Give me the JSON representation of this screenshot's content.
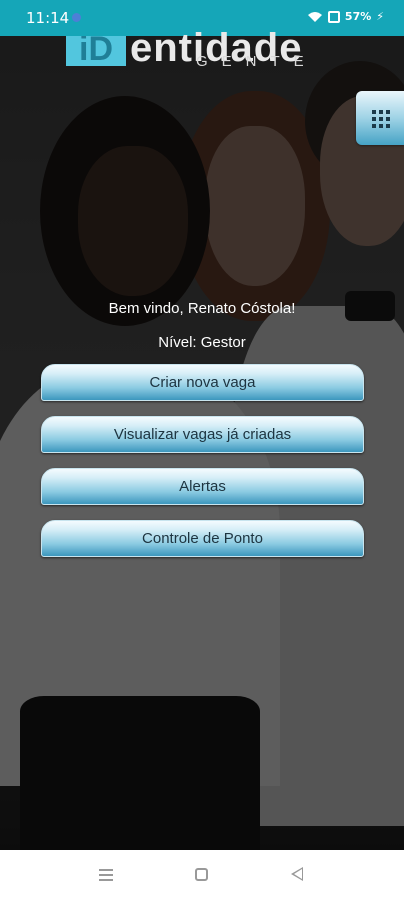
{
  "status_bar": {
    "time": "11:14",
    "battery": "57%",
    "icons": [
      "wifi-icon",
      "sim-icon",
      "charging-bolt-icon"
    ],
    "background": "#15a6b8"
  },
  "logo": {
    "mark": "iD",
    "word": "entidade",
    "sub": "GENTE"
  },
  "header": {
    "menu_icon": "grid-menu-icon"
  },
  "main": {
    "welcome": "Bem vindo, Renato Cóstola!",
    "level": "Nível: Gestor",
    "buttons": [
      {
        "label": "Criar nova vaga"
      },
      {
        "label": "Visualizar vagas já criadas"
      },
      {
        "label": "Alertas"
      },
      {
        "label": "Controle de Ponto"
      }
    ]
  },
  "nav_bar": {
    "icons": [
      "recent-apps-icon",
      "home-icon",
      "back-icon"
    ]
  },
  "colors": {
    "accent": "#15a6b8",
    "button_top": "#f4fbfe",
    "button_bottom": "#3c97bd",
    "text_on_button": "#1d3440"
  }
}
